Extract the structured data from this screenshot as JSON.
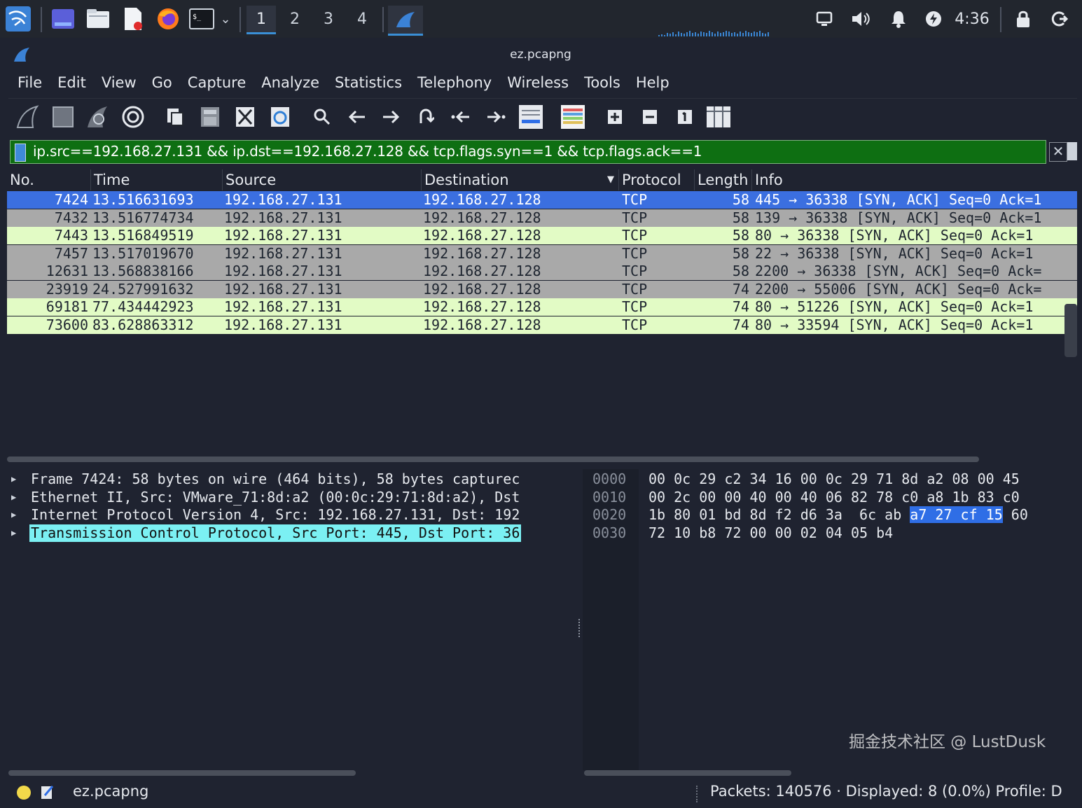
{
  "taskbar": {
    "workspaces": [
      "1",
      "2",
      "3",
      "4"
    ],
    "active_workspace": "1",
    "clock": "4:36"
  },
  "window": {
    "title": "ez.pcapng"
  },
  "menu": [
    "File",
    "Edit",
    "View",
    "Go",
    "Capture",
    "Analyze",
    "Statistics",
    "Telephony",
    "Wireless",
    "Tools",
    "Help"
  ],
  "filter": {
    "text": "ip.src==192.168.27.131 && ip.dst==192.168.27.128 && tcp.flags.syn==1 && tcp.flags.ack==1",
    "background": "#0e6f12"
  },
  "columns": [
    "No.",
    "Time",
    "Source",
    "Destination",
    "Protocol",
    "Length",
    "Info"
  ],
  "packets": [
    {
      "no": "7424",
      "time": "13.516631693",
      "src": "192.168.27.131",
      "dst": "192.168.27.128",
      "proto": "TCP",
      "len": "58",
      "info": "445 → 36338 [SYN, ACK] Seq=0 Ack=1",
      "color": "#3b6fe0",
      "selected": true
    },
    {
      "no": "7432",
      "time": "13.516774734",
      "src": "192.168.27.131",
      "dst": "192.168.27.128",
      "proto": "TCP",
      "len": "58",
      "info": "139 → 36338 [SYN, ACK] Seq=0 Ack=1",
      "color": "#a9a9a9",
      "selected": false
    },
    {
      "no": "7443",
      "time": "13.516849519",
      "src": "192.168.27.131",
      "dst": "192.168.27.128",
      "proto": "TCP",
      "len": "58",
      "info": "80 → 36338 [SYN, ACK] Seq=0 Ack=1",
      "color": "#e2fbc5",
      "selected": false
    },
    {
      "no": "7457",
      "time": "13.517019670",
      "src": "192.168.27.131",
      "dst": "192.168.27.128",
      "proto": "TCP",
      "len": "58",
      "info": "22 → 36338 [SYN, ACK] Seq=0 Ack=1",
      "color": "#a9a9a9",
      "selected": false
    },
    {
      "no": "12631",
      "time": "13.568838166",
      "src": "192.168.27.131",
      "dst": "192.168.27.128",
      "proto": "TCP",
      "len": "58",
      "info": "2200 → 36338 [SYN, ACK] Seq=0 Ack=",
      "color": "#a9a9a9",
      "selected": false
    },
    {
      "no": "23919",
      "time": "24.527991632",
      "src": "192.168.27.131",
      "dst": "192.168.27.128",
      "proto": "TCP",
      "len": "74",
      "info": "2200 → 55006 [SYN, ACK] Seq=0 Ack=",
      "color": "#a9a9a9",
      "selected": false
    },
    {
      "no": "69181",
      "time": "77.434442923",
      "src": "192.168.27.131",
      "dst": "192.168.27.128",
      "proto": "TCP",
      "len": "74",
      "info": "80 → 51226 [SYN, ACK] Seq=0 Ack=1",
      "color": "#e2fbc5",
      "selected": false
    },
    {
      "no": "73600",
      "time": "83.628863312",
      "src": "192.168.27.131",
      "dst": "192.168.27.128",
      "proto": "TCP",
      "len": "74",
      "info": "80 → 33594 [SYN, ACK] Seq=0 Ack=1",
      "color": "#e2fbc5",
      "selected": false
    }
  ],
  "details": [
    {
      "text": "Frame 7424: 58 bytes on wire (464 bits), 58 bytes capturec",
      "selected": false
    },
    {
      "text": "Ethernet II, Src: VMware_71:8d:a2 (00:0c:29:71:8d:a2), Dst",
      "selected": false
    },
    {
      "text": "Internet Protocol Version 4, Src: 192.168.27.131, Dst: 192",
      "selected": false
    },
    {
      "text": "Transmission Control Protocol, Src Port: 445, Dst Port: 36",
      "selected": true
    }
  ],
  "hex": [
    {
      "offset": "0000",
      "pre": "00 0c 29 c2 34 16 00 0c  29 71 8d a2 08 00 45",
      "hl": "",
      "post": ""
    },
    {
      "offset": "0010",
      "pre": "00 2c 00 00 40 00 40 06  82 78 c0 a8 1b 83 c0",
      "hl": "",
      "post": ""
    },
    {
      "offset": "0020",
      "pre": "1b 80 01 bd 8d f2 d6 3a  6c ab ",
      "hl": "a7 27 cf 15",
      "post": " 60"
    },
    {
      "offset": "0030",
      "pre": "72 10 b8 72 00 00 02 04  05 b4",
      "hl": "",
      "post": ""
    }
  ],
  "status": {
    "file": "ez.pcapng",
    "packets": "Packets: 140576 · Displayed: 8 (0.0%)",
    "profile": "Profile: D"
  },
  "watermark": "掘金技术社区 @ LustDusk"
}
